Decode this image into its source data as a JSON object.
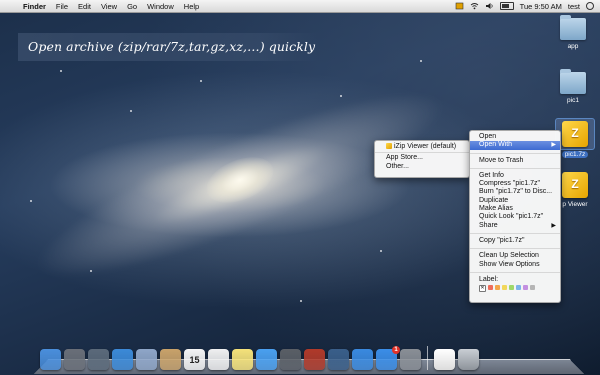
{
  "menubar": {
    "apple_glyph": "",
    "items": [
      "Finder",
      "File",
      "Edit",
      "View",
      "Go",
      "Window",
      "Help"
    ],
    "clock": "Tue 9:50 AM",
    "user": "test"
  },
  "banner": {
    "text": "Open archive (zip/rar/7z,tar,gz,xz,…) quickly"
  },
  "desktop_icons": [
    {
      "label": "app",
      "kind": "folder"
    },
    {
      "label": "pic1",
      "kind": "folder"
    },
    {
      "label": "pic1.7z",
      "kind": "archive"
    },
    {
      "label": "p Viewer",
      "kind": "archive"
    }
  ],
  "context_menu": {
    "open": "Open",
    "open_with": "Open With",
    "move_to_trash": "Move to Trash",
    "get_info": "Get Info",
    "compress": "Compress \"pic1.7z\"",
    "burn": "Burn \"pic1.7z\" to Disc...",
    "duplicate": "Duplicate",
    "make_alias": "Make Alias",
    "quick_look": "Quick Look \"pic1.7z\"",
    "share": "Share",
    "copy": "Copy \"pic1.7z\"",
    "clean_up": "Clean Up Selection",
    "show_view_options": "Show View Options",
    "label": "Label:",
    "label_colors": [
      "#ee6d5b",
      "#f3a64a",
      "#f2d75a",
      "#9fd86a",
      "#7db3ea",
      "#c38fe0",
      "#b5b5b5"
    ]
  },
  "submenu": {
    "izip_default": "iZip Viewer (default)",
    "app_store": "App Store...",
    "other": "Other..."
  },
  "dock": {
    "apps": [
      {
        "icon": "finder-icon",
        "color": "#4a8fdc"
      },
      {
        "icon": "launchpad-icon",
        "color": "#6a6f78"
      },
      {
        "icon": "mission-control-icon",
        "color": "#5b6a7a"
      },
      {
        "icon": "safari-icon",
        "color": "#3c8ad8"
      },
      {
        "icon": "mail-icon",
        "color": "#8fa6c8"
      },
      {
        "icon": "contacts-icon",
        "color": "#c9a26a"
      },
      {
        "icon": "calendar-icon",
        "color": "#f4f4f4"
      },
      {
        "icon": "reminders-icon",
        "color": "#f0f0f0"
      },
      {
        "icon": "notes-icon",
        "color": "#f5e27a"
      },
      {
        "icon": "messages-icon",
        "color": "#4aa0f0"
      },
      {
        "icon": "facetime-icon",
        "color": "#5a5f66"
      },
      {
        "icon": "photo-booth-icon",
        "color": "#b13a2a"
      },
      {
        "icon": "iphoto-icon",
        "color": "#3a5f8a"
      },
      {
        "icon": "itunes-icon",
        "color": "#3a8ae0"
      },
      {
        "icon": "app-store-icon",
        "color": "#3b8ee8"
      },
      {
        "icon": "system-preferences-icon",
        "color": "#8a8f96"
      }
    ],
    "calendar_day": "15",
    "app_store_badge": "1"
  },
  "colors": {
    "highlight": "#3e6bd2",
    "menu_bg": "#f8f8f8"
  }
}
